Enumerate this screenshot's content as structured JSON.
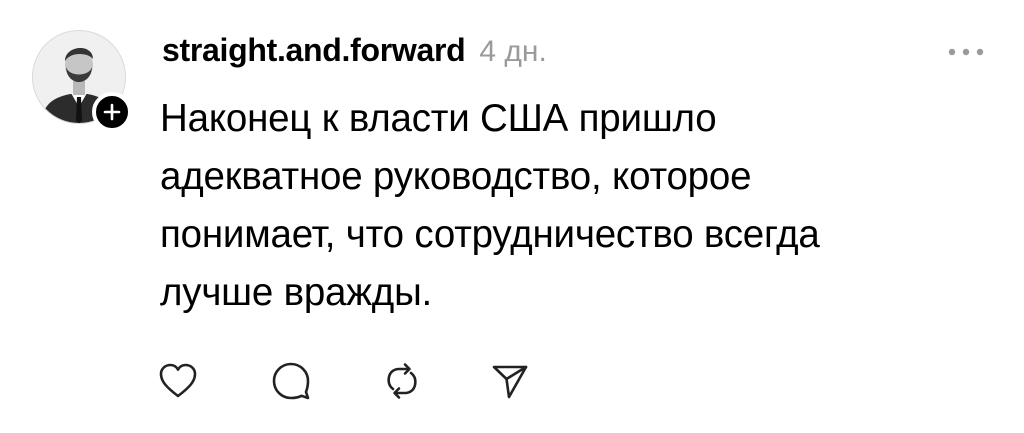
{
  "post": {
    "username": "straight.and.forward",
    "timestamp": "4 дн.",
    "text_lines": [
      "Наконец к власти США пришло",
      "адекватное руководство, которое",
      "понимает, что сотрудничество всегда",
      "лучше вражды."
    ]
  },
  "icons": {
    "follow": "plus-icon",
    "more": "more-horizontal-icon",
    "like": "heart-icon",
    "comment": "comment-icon",
    "repost": "repost-icon",
    "share": "send-icon"
  },
  "colors": {
    "text": "#000000",
    "timestamp": "#9a9a9a",
    "icon": "#222222",
    "background": "#ffffff"
  }
}
